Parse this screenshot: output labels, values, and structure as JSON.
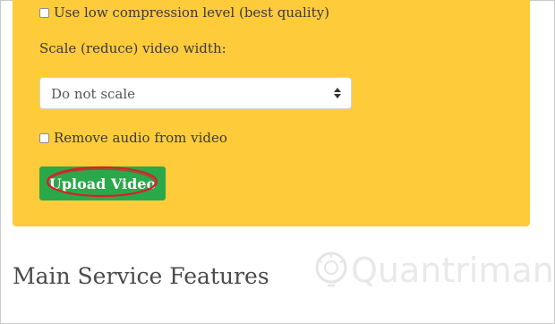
{
  "options": {
    "low_compression_label": "Use low compression level (best quality)",
    "scale_label": "Scale (reduce) video width:",
    "scale_selected": "Do not scale",
    "remove_audio_label": "Remove audio from video"
  },
  "upload": {
    "button_label": "Upload Video"
  },
  "section": {
    "heading": "Main Service Features"
  },
  "watermark": {
    "text": "Quantrimang"
  },
  "colors": {
    "panel": "#fecc3a",
    "button": "#2aa84a",
    "highlight_circle": "#d8202a"
  },
  "icons": {
    "select_arrows": "sort-arrows-icon",
    "watermark_logo": "lightbulb-logo-icon"
  }
}
